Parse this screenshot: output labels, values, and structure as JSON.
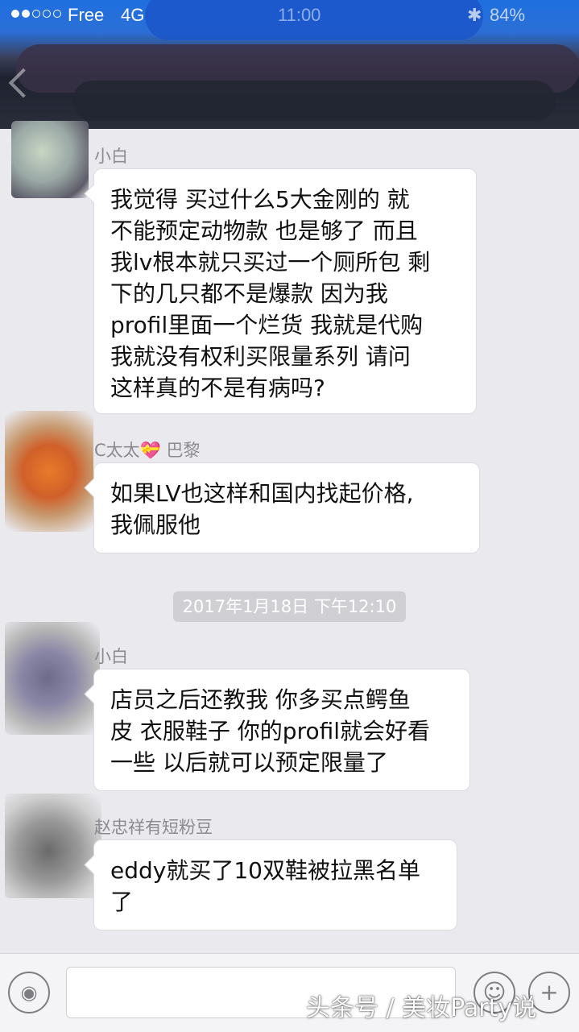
{
  "status_bar": {
    "carrier": "Free",
    "network": "4G",
    "time": "11:00",
    "battery": "84%"
  },
  "messages": [
    {
      "sender": "小白",
      "lines": [
        "我觉得 买过什么5大金刚的 就",
        "不能预定动物款 也是够了 而且",
        "我lv根本就只买过一个厕所包 剩",
        "下的几只都不是爆款 因为我",
        "profil里面一个烂货 我就是代购",
        "我就没有权利买限量系列 请问",
        "这样真的不是有病吗?"
      ]
    },
    {
      "sender": "C太太💝 巴黎",
      "lines": [
        "如果LV也这样和国内找起价格,",
        "我佩服他"
      ]
    },
    {
      "sender": "小白",
      "lines": [
        "店员之后还教我 你多买点鳄鱼",
        "皮 衣服鞋子 你的profil就会好看",
        "一些 以后就可以预定限量了"
      ]
    },
    {
      "sender": "赵忠祥有短粉豆",
      "lines": [
        "eddy就买了10双鞋被拉黑名单",
        "了"
      ]
    }
  ],
  "timestamp": "2017年1月18日 下午12:10",
  "watermark": "头条号 / 美妆Party说",
  "colors": {
    "background": "#e9e9ee",
    "bubble": "#ffffff",
    "sender_text": "#8a8a8f"
  }
}
